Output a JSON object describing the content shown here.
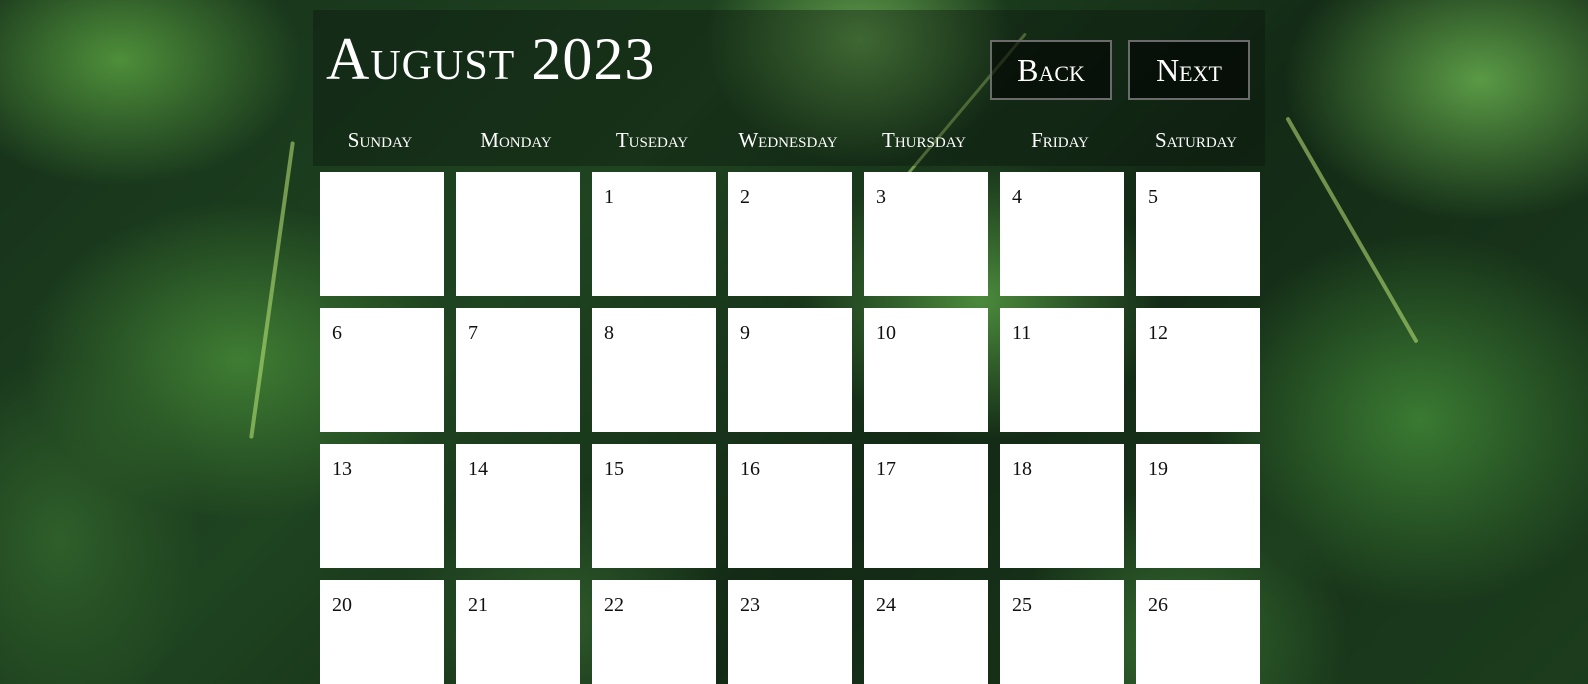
{
  "header": {
    "title": "August 2023",
    "back_label": "Back",
    "next_label": "Next"
  },
  "weekdays": [
    "Sunday",
    "Monday",
    "Tuseday",
    "Wednesday",
    "Thursday",
    "Friday",
    "Saturday"
  ],
  "weeks": [
    [
      "",
      "",
      "1",
      "2",
      "3",
      "4",
      "5"
    ],
    [
      "6",
      "7",
      "8",
      "9",
      "10",
      "11",
      "12"
    ],
    [
      "13",
      "14",
      "15",
      "16",
      "17",
      "18",
      "19"
    ],
    [
      "20",
      "21",
      "22",
      "23",
      "24",
      "25",
      "26"
    ]
  ],
  "colors": {
    "cell_background": "#ffffff",
    "header_text": "#ffffff",
    "background_theme": "#1f4420"
  }
}
